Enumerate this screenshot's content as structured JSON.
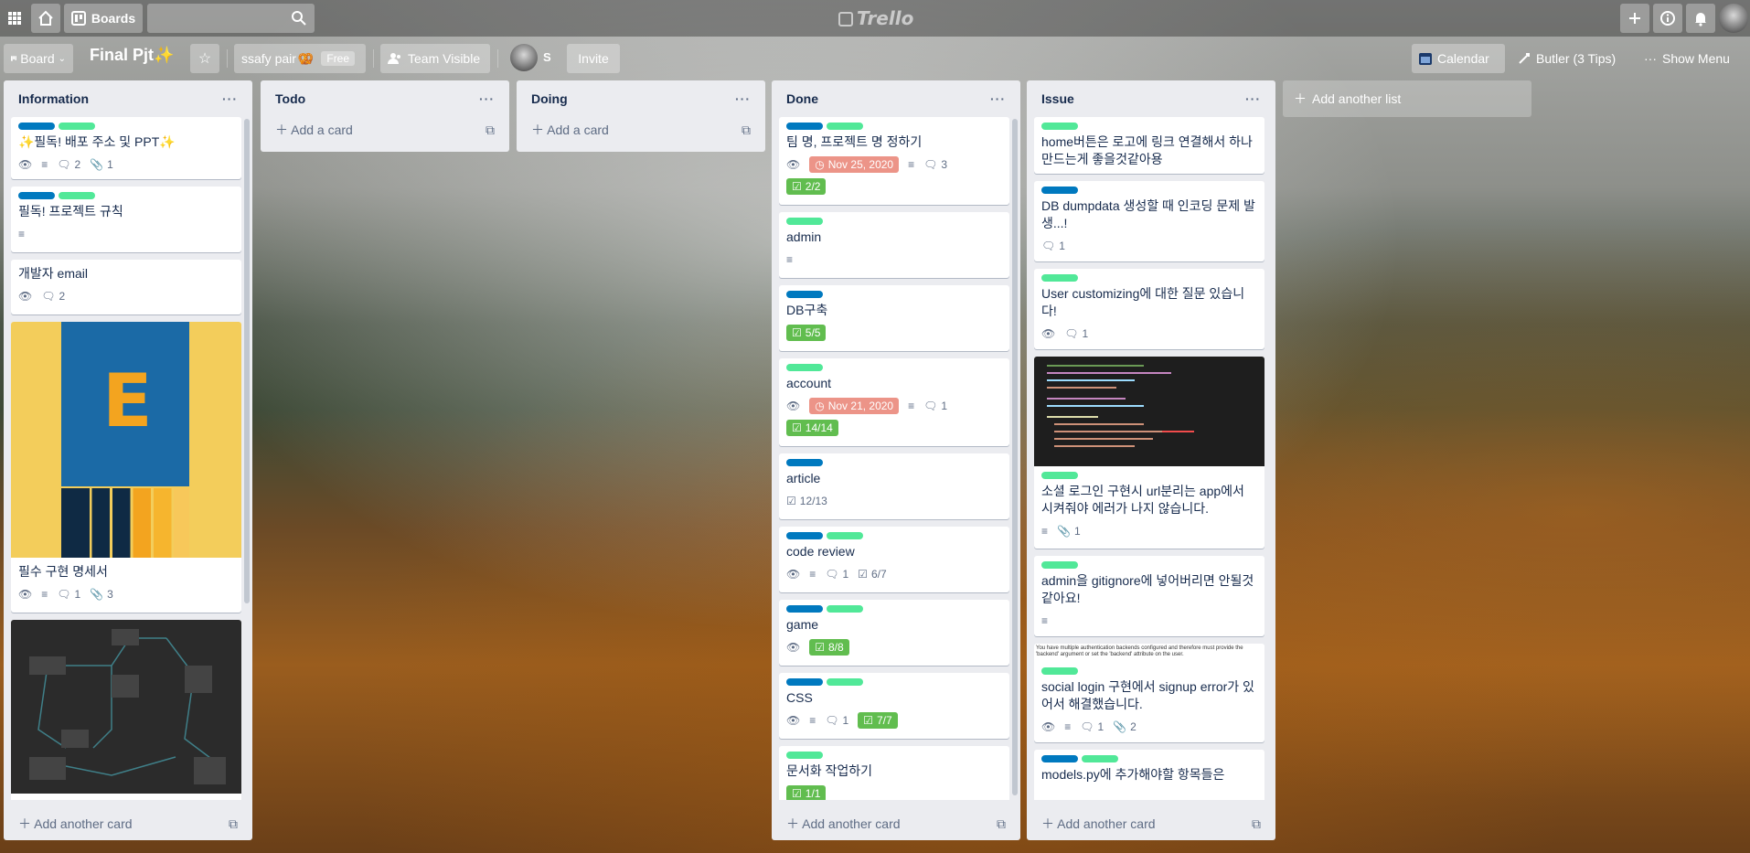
{
  "topnav": {
    "boards_label": "Boards",
    "logo": "Trello",
    "icons": [
      "apps-icon",
      "home-icon",
      "boards-icon",
      "search-icon",
      "add-icon",
      "info-icon",
      "notification-icon",
      "avatar"
    ]
  },
  "board": {
    "view_label": "Board",
    "title": "Final Pjt",
    "team": "ssafy pair",
    "plan_badge": "Free",
    "visibility": "Team Visible",
    "member_initial": "S",
    "invite_label": "Invite",
    "calendar_label": "Calendar",
    "butler_label": "Butler (3 Tips)",
    "show_menu_label": "Show Menu"
  },
  "colors": {
    "label_blue": "#0079bf",
    "label_green": "#51e898",
    "due_red": "#ec9488",
    "checklist_green": "#61bd4f"
  },
  "lists": [
    {
      "name": "Information",
      "footer": "Add another card",
      "cards": [
        {
          "title": "✨필독! 배포 주소 및 PPT✨",
          "comments": "2",
          "attachments": "1"
        },
        {
          "title": "필독! 프로젝트 규칙"
        },
        {
          "title": "개발자 email",
          "comments": "2"
        },
        {
          "title": "필수 구현 명세서",
          "comments": "1",
          "attachments": "3",
          "cover_letter": "E"
        },
        {
          "title": ""
        }
      ]
    },
    {
      "name": "Todo",
      "add_label": "Add a card"
    },
    {
      "name": "Doing",
      "add_label": "Add a card"
    },
    {
      "name": "Done",
      "footer": "Add another card",
      "cards": [
        {
          "title": "팀 명, 프로젝트 명 정하기",
          "due": "Nov 25, 2020",
          "comments": "3",
          "checklist": "2/2"
        },
        {
          "title": "admin"
        },
        {
          "title": "DB구축",
          "checklist": "5/5"
        },
        {
          "title": "account",
          "due": "Nov 21, 2020",
          "comments": "1",
          "checklist": "14/14"
        },
        {
          "title": "article",
          "checklist": "12/13"
        },
        {
          "title": "code review",
          "comments": "1",
          "checklist": "6/7"
        },
        {
          "title": "game",
          "checklist": "8/8"
        },
        {
          "title": "CSS",
          "comments": "1",
          "checklist": "7/7"
        },
        {
          "title": "문서화 작업하기",
          "checklist": "1/1"
        }
      ]
    },
    {
      "name": "Issue",
      "footer": "Add another card",
      "cards": [
        {
          "title": "home버튼은 로고에 링크 연결해서 하나 만드는게 좋을것같아용"
        },
        {
          "title": "DB dumpdata 생성할 때 인코딩 문제 발생...!",
          "comments": "1"
        },
        {
          "title": "User customizing에 대한 질문 있습니다!",
          "comments": "1"
        },
        {
          "title": "소셜 로그인 구현시 url분리는 app에서 시켜줘야 에러가 나지 않습니다.",
          "attachments": "1"
        },
        {
          "title": "admin을 gitignore에 넣어버리면 안될것같아요!"
        },
        {
          "cover_text": "You have multiple authentication backends configured and therefore must provide the 'backend' argument or set the 'backend' attribute on the user.",
          "title": "social login 구현에서 signup error가 있어서 해결했습니다.",
          "comments": "1",
          "attachments": "2"
        },
        {
          "title": "models.py에 추가해야할 항목들은"
        }
      ]
    }
  ],
  "add_list_label": "Add another list"
}
